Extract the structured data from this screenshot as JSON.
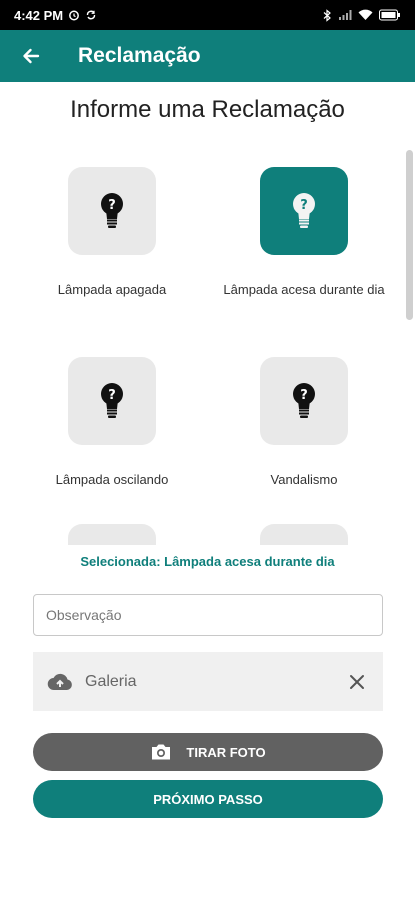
{
  "status_bar": {
    "time": "4:42 PM",
    "icons": [
      "alarm-icon",
      "sync-icon",
      "bluetooth-icon",
      "signal-icon",
      "wifi-icon",
      "battery-icon"
    ]
  },
  "app_bar": {
    "title": "Reclamação",
    "back_icon": "back-arrow-icon",
    "color": "#0f7f7b"
  },
  "heading": "Informe uma Reclamação",
  "options": [
    {
      "label": "Lâmpada apagada",
      "icon": "bulb-question-icon",
      "selected": false
    },
    {
      "label": "Lâmpada acesa durante dia",
      "icon": "bulb-question-icon",
      "selected": true
    },
    {
      "label": "Lâmpada oscilando",
      "icon": "bulb-question-icon",
      "selected": false
    },
    {
      "label": "Vandalismo",
      "icon": "bulb-question-icon",
      "selected": false
    }
  ],
  "selected_text": "Selecionada: Lâmpada acesa durante dia",
  "observacao": {
    "placeholder": "Observação",
    "value": ""
  },
  "gallery": {
    "label": "Galeria",
    "icon": "cloud-upload-icon",
    "close_icon": "close-icon"
  },
  "buttons": {
    "take_photo": "TIRAR FOTO",
    "next_step": "PRÓXIMO PASSO"
  },
  "colors": {
    "primary": "#0f7f7b",
    "tile_bg": "#e9e9e9",
    "photo_button": "#616161"
  }
}
